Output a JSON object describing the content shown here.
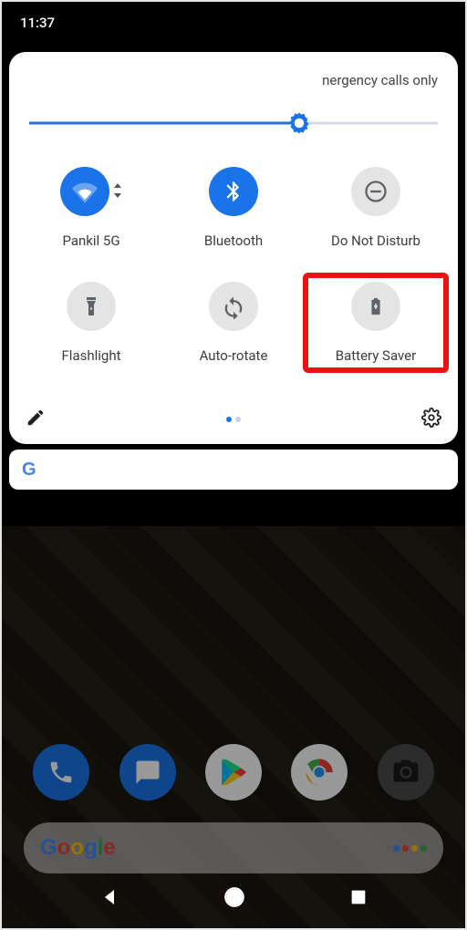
{
  "status": {
    "time": "11:37"
  },
  "panel": {
    "top_text": "nergency calls only",
    "brightness": {
      "value": 66
    },
    "tiles": [
      {
        "id": "wifi",
        "label": "Pankil 5G",
        "active": true,
        "icon": "wifi-icon",
        "expandable": true
      },
      {
        "id": "bluetooth",
        "label": "Bluetooth",
        "active": true,
        "icon": "bluetooth-icon",
        "expandable": false
      },
      {
        "id": "dnd",
        "label": "Do Not Disturb",
        "active": false,
        "icon": "dnd-icon",
        "expandable": false
      },
      {
        "id": "flashlight",
        "label": "Flashlight",
        "active": false,
        "icon": "flashlight-icon",
        "expandable": false
      },
      {
        "id": "autorotate",
        "label": "Auto-rotate",
        "active": false,
        "icon": "rotate-icon",
        "expandable": false
      },
      {
        "id": "battery",
        "label": "Battery Saver",
        "active": false,
        "icon": "battery-icon",
        "expandable": false,
        "highlighted": true
      }
    ],
    "pager": {
      "count": 2,
      "active": 0
    }
  },
  "search": {
    "logo_letter": "G"
  },
  "dock": [
    {
      "id": "phone",
      "name": "phone-app-icon"
    },
    {
      "id": "messages",
      "name": "messages-app-icon"
    },
    {
      "id": "play",
      "name": "play-store-icon"
    },
    {
      "id": "chrome",
      "name": "chrome-app-icon"
    },
    {
      "id": "camera",
      "name": "camera-app-icon"
    }
  ]
}
